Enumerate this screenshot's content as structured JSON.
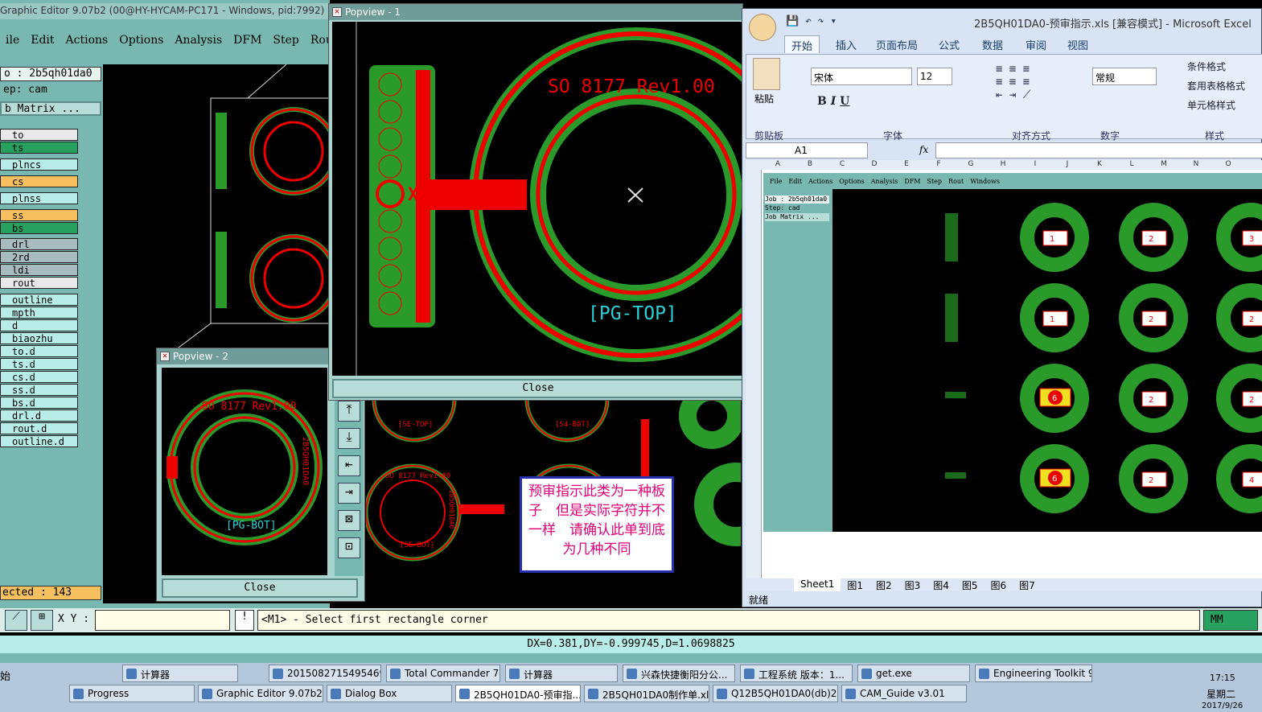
{
  "graphic_editor": {
    "title": "Graphic Editor 9.07b2 (00@HY-HYCAM-PC171 - Windows, pid:7992)",
    "menu": [
      "ile",
      "Edit",
      "Actions",
      "Options",
      "Analysis",
      "DFM",
      "Step",
      "Rout"
    ],
    "job": "o : 2b5qh01da0",
    "step": "ep: cam",
    "job_matrix": "b Matrix ...",
    "layers": [
      "to",
      "ts",
      "plncs",
      "cs",
      "plnss",
      "ss",
      "bs",
      "drl",
      "2rd",
      "ldi",
      "rout",
      "outline",
      "mpth",
      "d",
      "biaozhu",
      "to.d",
      "ts.d",
      "cs.d",
      "ss.d",
      "bs.d",
      "drl.d",
      "rout.d",
      "outline.d"
    ],
    "selected": "ected : 143",
    "xy_label": "X Y :",
    "prompt": "<M1> - Select first rectangle corner",
    "units": "MM",
    "measure": "DX=0.381,DY=-0.999745,D=1.0698825"
  },
  "popview1": {
    "title": "Popview - 1",
    "close": "Close",
    "text_so": "SO 8177 Rev1.00",
    "text_pg": "[PG-TOP]",
    "text_x1": "X1"
  },
  "popview2": {
    "title": "Popview - 2",
    "close": "Close",
    "text_so": "SO 8177 Rev1.00",
    "text_pg": "[PG-BOT]",
    "text_side": "2B5QH01DA0"
  },
  "canvas_labels": {
    "se_top": "[SE-TOP]",
    "s4_bot": "[S4-BOT]",
    "se_bot": "[SE-BOT]",
    "so_small": "SO 8177 Rev1.00",
    "side_small": "2B5QH01DA0",
    "pg_top": "[PG-TOP]",
    "pg_bot": "[PG-BOT]",
    "so_top": "SO 8177 Rev1.00",
    "x1": "X1"
  },
  "note": "预审指示此类为一种板子　但是实际字符并不一样　请确认此单到底为几种不同",
  "excel": {
    "title": "2B5QH01DA0-预审指示.xls  [兼容模式] - Microsoft Excel",
    "tabs": [
      "开始",
      "插入",
      "页面布局",
      "公式",
      "数据",
      "审阅",
      "视图"
    ],
    "groups": [
      "剪贴板",
      "字体",
      "对齐方式",
      "数字",
      "样式"
    ],
    "paste": "粘贴",
    "font": "宋体",
    "size": "12",
    "number_format": "常规",
    "styles": [
      "条件格式",
      "套用表格格式",
      "单元格样式"
    ],
    "name_box": "A1",
    "fx": "fx",
    "columns": [
      "A",
      "B",
      "C",
      "D",
      "E",
      "F",
      "G",
      "H",
      "I",
      "J",
      "K",
      "L",
      "M",
      "N",
      "O"
    ],
    "sheets": [
      "Sheet1",
      "图1",
      "图2",
      "图3",
      "图4",
      "图5",
      "图6",
      "图7"
    ],
    "status": "就绪",
    "inner_menu": [
      "File",
      "Edit",
      "Actions",
      "Options",
      "Analysis",
      "DFM",
      "Step",
      "Rout",
      "Windows"
    ],
    "inner_job": "Job : 2b5qh01da0",
    "inner_step": "Step: cad",
    "inner_matrix": "Job Matrix ...",
    "pad_labels": [
      "1",
      "2",
      "3",
      "1",
      "2",
      "2",
      "6",
      "2",
      "2",
      "6",
      "2",
      "4"
    ]
  },
  "taskbar": {
    "row1": [
      "计算器",
      "20150827154954694...",
      "Total Commander 7.0...",
      "计算器",
      "兴森快捷衡阳分公...",
      "工程系统  版本：1...",
      "get.exe",
      "Engineering Toolkit 9...."
    ],
    "row2": [
      "Progress",
      "Graphic Editor 9.07b2 (0...",
      "Dialog Box",
      "2B5QH01DA0-预审指...",
      "2B5QH01DA0制作单.xls...",
      "Q12B5QH01DA0(db)201...",
      "CAM_Guide v3.01"
    ],
    "start": "始",
    "time": "17:15",
    "day": "星期二",
    "date": "2017/9/26"
  }
}
